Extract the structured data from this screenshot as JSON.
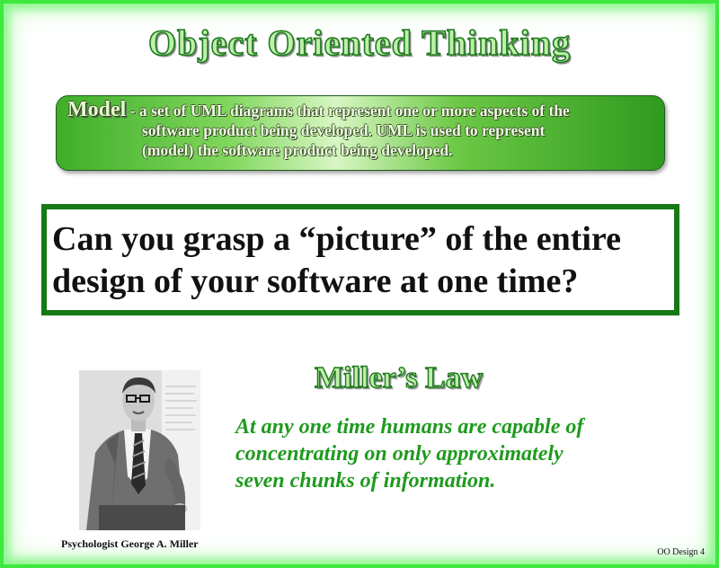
{
  "slide": {
    "title": "Object Oriented Thinking",
    "model": {
      "term": "Model",
      "line1": " - a set of UML diagrams that represent one or more aspects of the",
      "line2": "software product being developed.  UML is used to represent",
      "line3": "(model) the software product being developed."
    },
    "question": "Can you grasp a “picture” of the entire design of your software at one time?",
    "photo_caption": "Psychologist George A. Miller",
    "law": {
      "title": "Miller’s Law",
      "line1": " At any one time humans are capable of",
      "line2": "concentrating on only approximately",
      "line3": "seven chunks of information."
    },
    "footer": "OO Design 4"
  },
  "colors": {
    "frame": "#3ee83e",
    "title_fill": "#bdf0a8",
    "title_outline": "#1f7a1f",
    "question_border": "#157a15",
    "law_text": "#1e9a1e"
  }
}
